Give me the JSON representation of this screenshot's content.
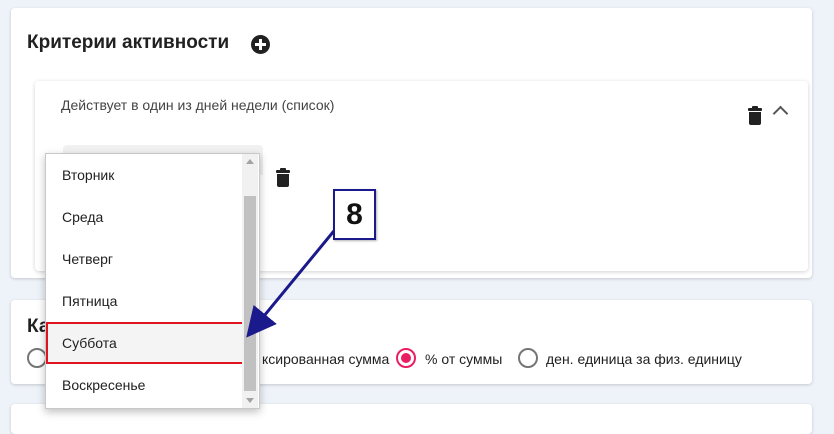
{
  "criteria": {
    "title": "Критерии активности",
    "item": {
      "label": "Действует в один из дней недели (список)"
    }
  },
  "dropdown": {
    "options": [
      "Вторник",
      "Среда",
      "Четверг",
      "Пятница",
      "Суббота",
      "Воскресенье"
    ],
    "highlighted": "Суббота"
  },
  "type_card": {
    "title": "Ка",
    "radio_options": [
      {
        "label": "ксированная сумма",
        "checked": false
      },
      {
        "label": "% от суммы",
        "checked": true
      },
      {
        "label": "ден. единица за физ. единицу",
        "checked": false
      }
    ]
  },
  "annotation": {
    "step_number": "8",
    "color": "#1a1a8c",
    "highlight_color": "#e0141e"
  }
}
